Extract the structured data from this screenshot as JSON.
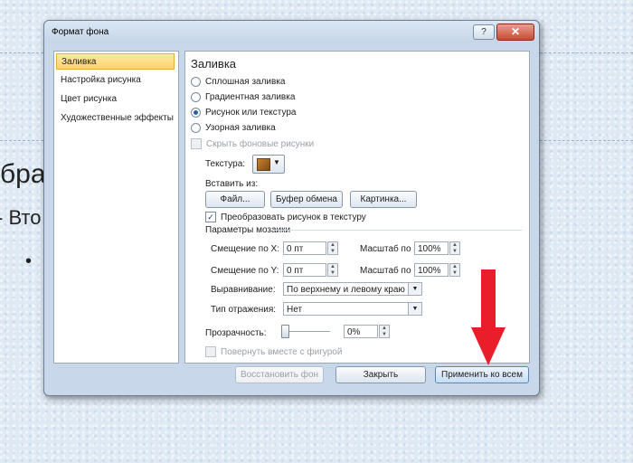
{
  "slide": {
    "text1": "бра",
    "text2": "- Вто",
    "bullet": "•"
  },
  "dialog": {
    "title": "Формат фона",
    "help": "?",
    "close": "✕",
    "nav": [
      {
        "label": "Заливка"
      },
      {
        "label": "Настройка рисунка"
      },
      {
        "label": "Цвет рисунка"
      },
      {
        "label": "Художественные эффекты"
      }
    ],
    "panel": {
      "section_title": "Заливка",
      "fill_options": [
        {
          "label": "Сплошная заливка",
          "selected": false
        },
        {
          "label": "Градиентная заливка",
          "selected": false
        },
        {
          "label": "Рисунок или текстура",
          "selected": true
        },
        {
          "label": "Узорная заливка",
          "selected": false
        }
      ],
      "hide_bg_label": "Скрыть фоновые рисунки",
      "texture_label": "Текстура:",
      "insert_from_label": "Вставить из:",
      "insert_buttons": [
        "Файл...",
        "Буфер обмена",
        "Картинка..."
      ],
      "tile_label": "Преобразовать рисунок в текстуру",
      "tile_checked": true,
      "tiling_group": "Параметры мозаики",
      "offset_x_label": "Смещение по X:",
      "offset_x": "0 пт",
      "scale_x_label": "Масштаб по X:",
      "scale_x": "100%",
      "offset_y_label": "Смещение по Y:",
      "offset_y": "0 пт",
      "scale_y_label": "Масштаб по Y:",
      "scale_y": "100%",
      "alignment_label": "Выравнивание:",
      "alignment": "По верхнему и левому краю",
      "mirror_label": "Тип отражения:",
      "mirror": "Нет",
      "transparency_label": "Прозрачность:",
      "transparency": "0%",
      "rotate_label": "Повернуть вместе с фигурой"
    },
    "footer": {
      "reset": "Восстановить фон",
      "close": "Закрыть",
      "apply_all": "Применить ко всем"
    }
  },
  "colors": {
    "accent_arrow": "#ea1d2b",
    "selected_nav": "#ffd46a"
  }
}
